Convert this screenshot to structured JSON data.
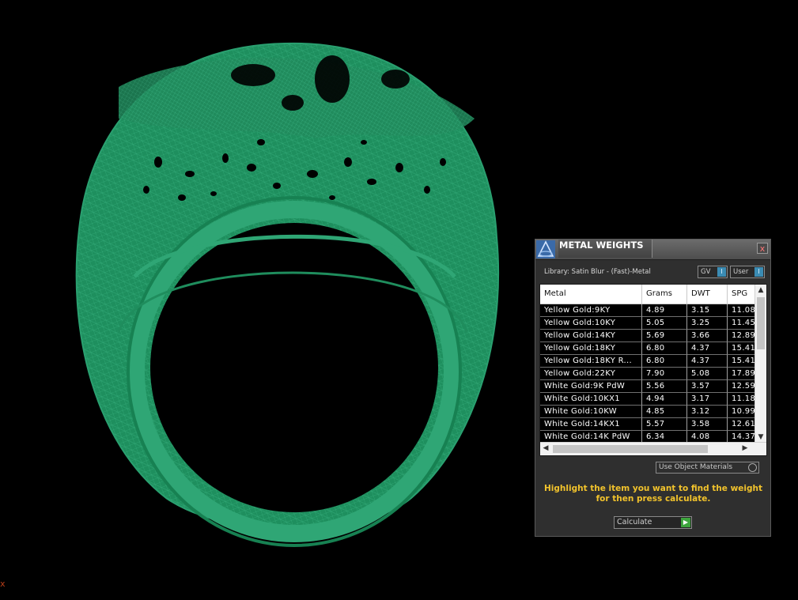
{
  "viewport": {
    "model_color": "#1e8f5e",
    "axis_label": "x"
  },
  "panel": {
    "title": "METAL WEIGHTS",
    "close_glyph": "x",
    "library_label": "Library: Satin Blur - (Fast)-Metal",
    "toggle_gv": "GV",
    "toggle_user": "User",
    "toggle_knob": "I",
    "columns": [
      "Metal",
      "Grams",
      "DWT",
      "SPG"
    ],
    "rows": [
      [
        "Yellow Gold:9KY",
        "4.89",
        "3.15",
        "11.08"
      ],
      [
        "Yellow Gold:10KY",
        "5.05",
        "3.25",
        "11.45"
      ],
      [
        "Yellow Gold:14KY",
        "5.69",
        "3.66",
        "12.89"
      ],
      [
        "Yellow Gold:18KY",
        "6.80",
        "4.37",
        "15.41"
      ],
      [
        "Yellow Gold:18KY R...",
        "6.80",
        "4.37",
        "15.41"
      ],
      [
        "Yellow Gold:22KY",
        "7.90",
        "5.08",
        "17.89"
      ],
      [
        "White Gold:9K PdW",
        "5.56",
        "3.57",
        "12.59"
      ],
      [
        "White Gold:10KX1",
        "4.94",
        "3.17",
        "11.18"
      ],
      [
        "White Gold:10KW",
        "4.85",
        "3.12",
        "10.99"
      ],
      [
        "White Gold:14KX1",
        "5.57",
        "3.58",
        "12.61"
      ],
      [
        "White Gold:14K PdW",
        "6.34",
        "4.08",
        "14.37"
      ]
    ],
    "use_object_materials": "Use Object Materials",
    "instructions_line1": "Highlight the item you want to find the weight",
    "instructions_line2": "for then press calculate.",
    "calculate_label": "Calculate",
    "colors": {
      "accent_blue": "#3b8cb4",
      "instruction_yellow": "#f2c32c",
      "go_green": "#3da53d"
    }
  }
}
